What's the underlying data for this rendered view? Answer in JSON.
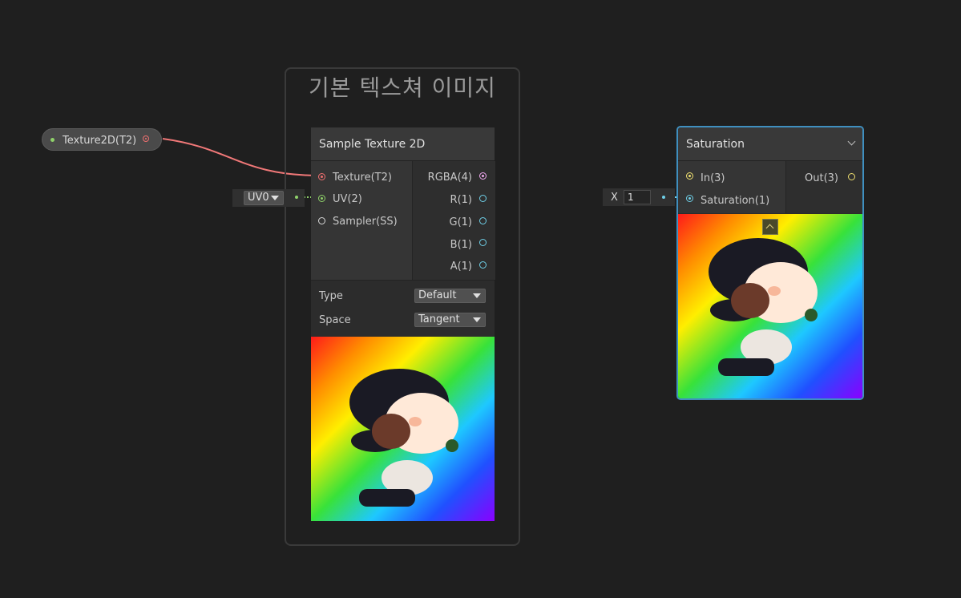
{
  "group": {
    "title": "기본 텍스쳐 이미지"
  },
  "property_node": {
    "label": "Texture2D(T2)"
  },
  "sample_texture": {
    "title": "Sample Texture 2D",
    "inputs": [
      "Texture(T2)",
      "UV(2)",
      "Sampler(SS)"
    ],
    "outputs": [
      "RGBA(4)",
      "R(1)",
      "G(1)",
      "B(1)",
      "A(1)"
    ],
    "type_label": "Type",
    "type_value": "Default",
    "space_label": "Space",
    "space_value": "Tangent"
  },
  "uv_input": {
    "value": "UV0"
  },
  "saturation": {
    "title": "Saturation",
    "inputs": [
      "In(3)",
      "Saturation(1)"
    ],
    "output": "Out(3)"
  },
  "x_input": {
    "label": "X",
    "value": "1"
  },
  "colors": {
    "background": "#1f1f1f",
    "texture_port": "#f07070",
    "vector2_port": "#8fd16a",
    "float_port": "#6fd0e8",
    "vector4_port": "#f0a8f0",
    "vector3_port": "#f0e070",
    "selection": "#3f8fbf"
  }
}
